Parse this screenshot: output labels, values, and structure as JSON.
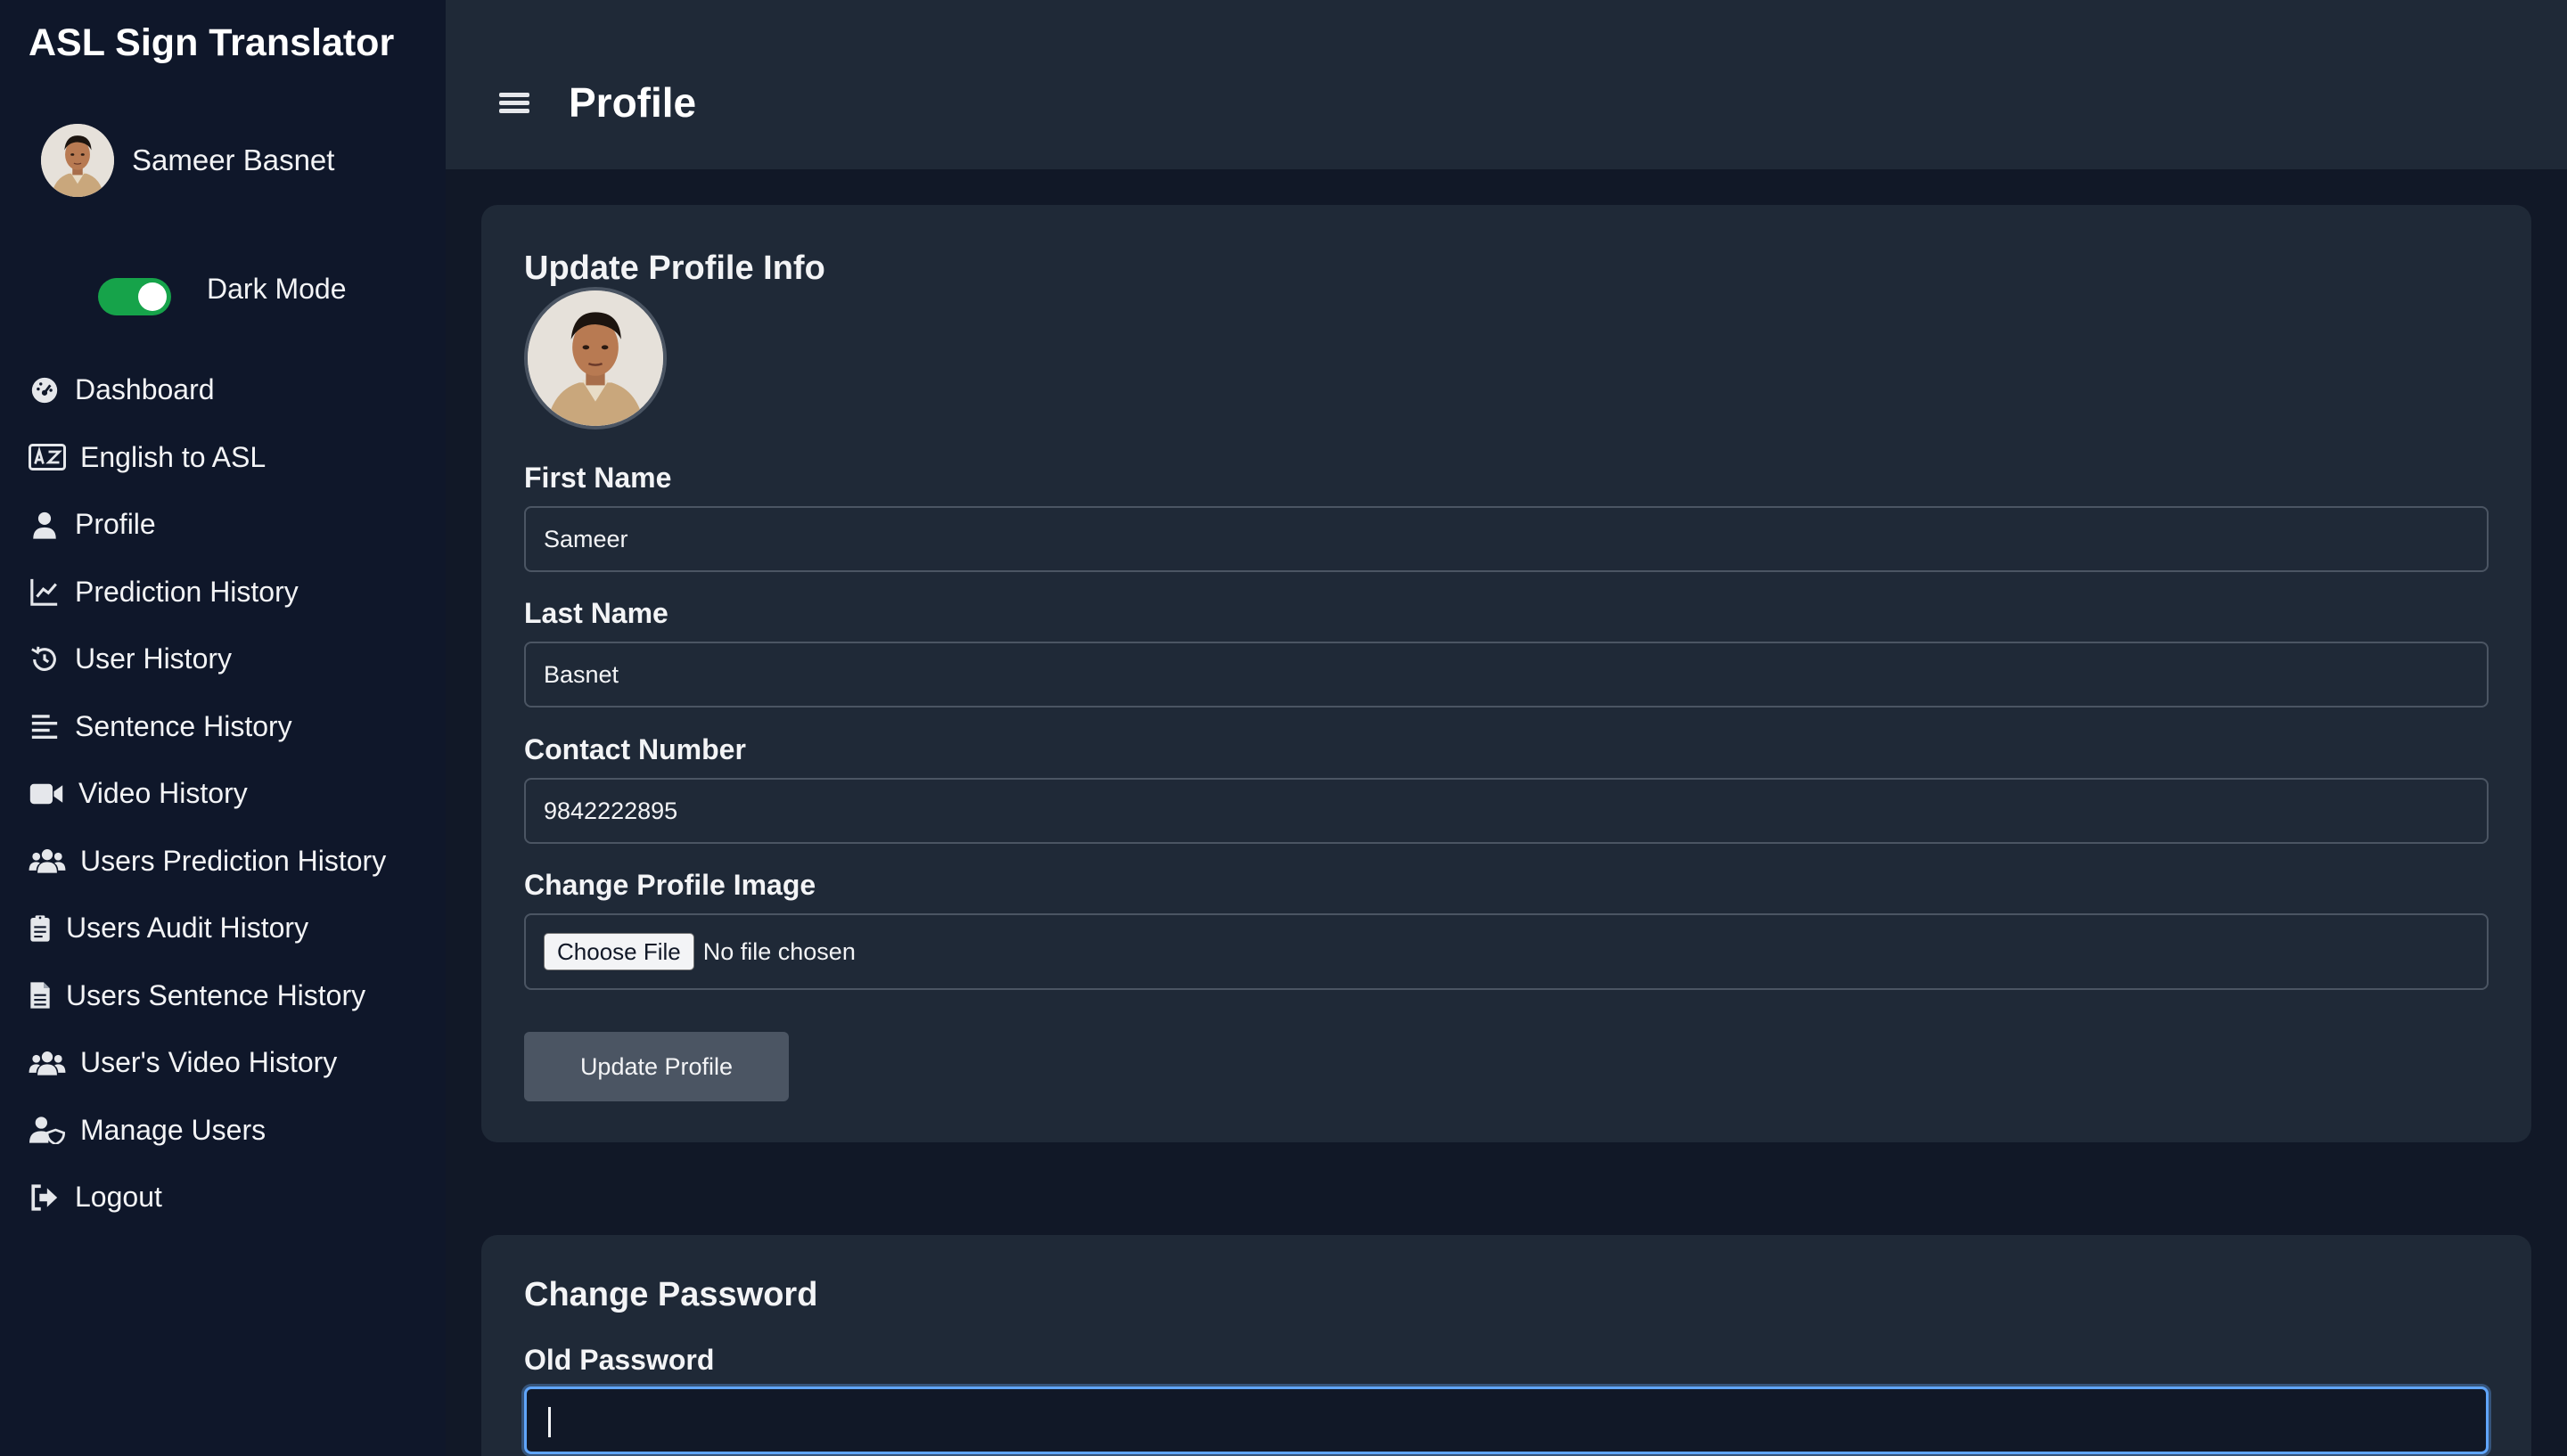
{
  "sidebar": {
    "brand": "ASL Sign Translator",
    "user_name": "Sameer Basnet",
    "dark_mode_label": "Dark Mode",
    "dark_mode_on": true,
    "items": [
      {
        "label": "Dashboard",
        "icon": "dashboard-icon"
      },
      {
        "label": "English to ASL",
        "icon": "language-card-icon"
      },
      {
        "label": "Profile",
        "icon": "user-icon"
      },
      {
        "label": "Prediction History",
        "icon": "line-chart-icon"
      },
      {
        "label": "User History",
        "icon": "history-icon"
      },
      {
        "label": "Sentence History",
        "icon": "align-left-icon"
      },
      {
        "label": "Video History",
        "icon": "video-icon"
      },
      {
        "label": "Users Prediction History",
        "icon": "users-icon"
      },
      {
        "label": "Users Audit History",
        "icon": "clipboard-icon"
      },
      {
        "label": "Users Sentence History",
        "icon": "file-text-icon"
      },
      {
        "label": "User's Video History",
        "icon": "users-icon"
      },
      {
        "label": "Manage Users",
        "icon": "user-shield-icon"
      },
      {
        "label": "Logout",
        "icon": "logout-icon"
      }
    ]
  },
  "header": {
    "title": "Profile"
  },
  "profile_form": {
    "title": "Update Profile Info",
    "first_name_label": "First Name",
    "first_name_value": "Sameer",
    "last_name_label": "Last Name",
    "last_name_value": "Basnet",
    "contact_label": "Contact Number",
    "contact_value": "9842222895",
    "image_label": "Change Profile Image",
    "choose_file_label": "Choose File",
    "file_status": "No file chosen",
    "submit_label": "Update Profile"
  },
  "password_form": {
    "title": "Change Password",
    "old_password_label": "Old Password"
  },
  "colors": {
    "sidebar_bg": "#0f172a",
    "content_bg": "#111827",
    "card_bg": "#1f2937",
    "toggle_on": "#16a34a",
    "focus_ring": "#60a5fa",
    "button_bg": "#4b5563"
  }
}
